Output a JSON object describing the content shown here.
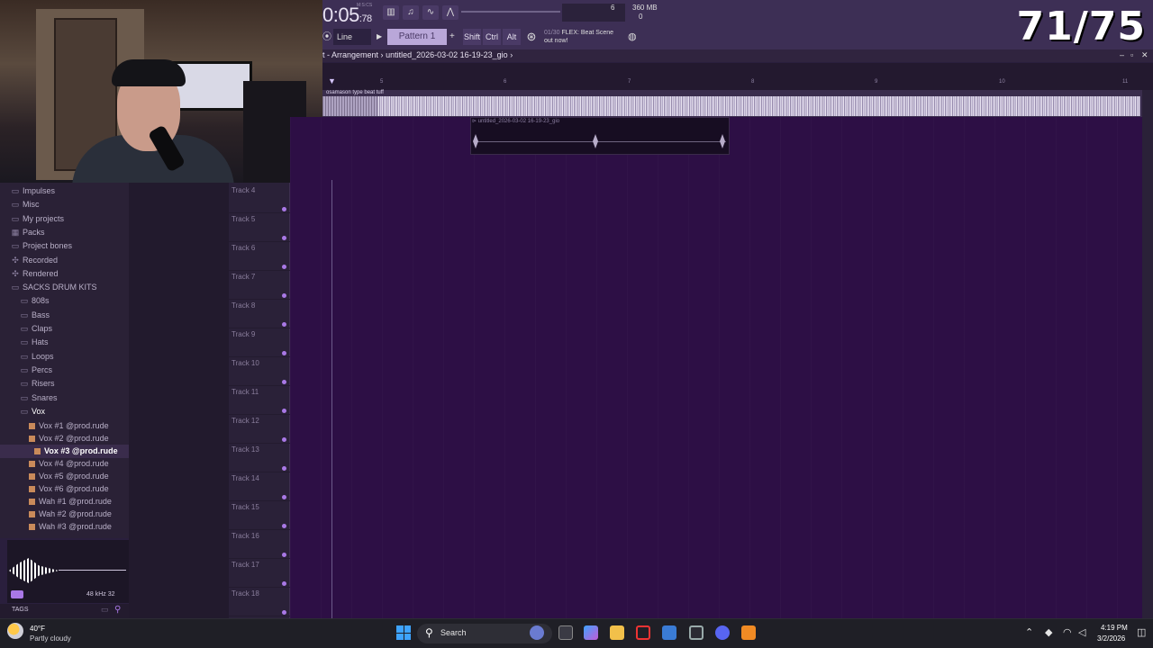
{
  "counter": "71/75",
  "toolbar": {
    "time": "0:05",
    "time_small": ":78",
    "time_unit_label": "M:S:CS",
    "meter_value": "6",
    "meter_zero": "0",
    "memory": "360 MB",
    "snap": "Line",
    "pattern": "Pattern 1",
    "pattern_add": "+",
    "keys": [
      "Shift",
      "Ctrl",
      "Alt"
    ],
    "news_count": "01/30",
    "news_line1": "FLEX: Beat Scene",
    "news_line2": "out now!"
  },
  "arrangement": {
    "title": "t - Arrangement",
    "breadcrumb_sep": "›",
    "project": "untitled_2026-03-02 16-19-23_gio",
    "bar_numbers": [
      "5",
      "6",
      "7",
      "8",
      "9",
      "10",
      "11"
    ]
  },
  "audio_track": {
    "label": "osamason type beat tuff"
  },
  "clip": {
    "title": "untitled_2026-03-02 16-19-23_gio"
  },
  "tracks": [
    "Track 4",
    "Track 5",
    "Track 6",
    "Track 7",
    "Track 8",
    "Track 9",
    "Track 10",
    "Track 11",
    "Track 12",
    "Track 13",
    "Track 14",
    "Track 15",
    "Track 16",
    "Track 17",
    "Track 18"
  ],
  "browser": {
    "items": [
      {
        "label": "Impulses",
        "icon": "folder-icon"
      },
      {
        "label": "Misc",
        "icon": "folder-icon"
      },
      {
        "label": "My projects",
        "icon": "folder-icon"
      },
      {
        "label": "Packs",
        "icon": "packs-icon"
      },
      {
        "label": "Project bones",
        "icon": "folder-icon"
      },
      {
        "label": "Recorded",
        "icon": "plus-icon"
      },
      {
        "label": "Rendered",
        "icon": "plus-icon"
      },
      {
        "label": "SACKS DRUM KITS",
        "icon": "folder-open-icon"
      }
    ],
    "sub_items": [
      "808s",
      "Bass",
      "Claps",
      "Hats",
      "Loops",
      "Percs",
      "Risers",
      "Snares",
      "Vox"
    ],
    "files": [
      "Vox #1 @prod.rude",
      "Vox #2 @prod.rude",
      "Vox #3 @prod.rude",
      "Vox #4 @prod.rude",
      "Vox #5 @prod.rude",
      "Vox #6 @prod.rude",
      "Wah #1 @prod.rude",
      "Wah #2 @prod.rude",
      "Wah #3 @prod.rude"
    ],
    "selected_file_index": 2,
    "preview_info": "48 kHz 32",
    "tags_label": "TAGS"
  },
  "taskbar": {
    "weather_temp": "40°F",
    "weather_desc": "Partly cloudy",
    "search_text": "Search",
    "clock_time": "4:19 PM",
    "clock_date": "3/2/2026"
  },
  "colors": {
    "accent": "#a978e6",
    "playlist_bg": "#2d0f45",
    "windows_blue": "#3ea3ff"
  }
}
